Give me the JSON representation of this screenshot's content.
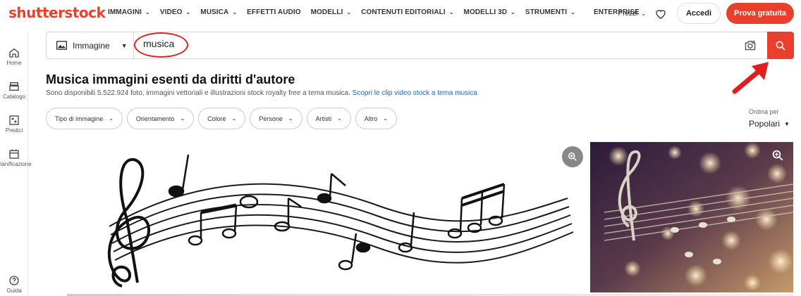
{
  "brand": {
    "logo_text": "shutterstock",
    "accent": "#e8402c"
  },
  "nav": {
    "items": [
      {
        "label": "IMMAGINI",
        "has_dropdown": true
      },
      {
        "label": "VIDEO",
        "has_dropdown": true
      },
      {
        "label": "MUSICA",
        "has_dropdown": true
      },
      {
        "label": "EFFETTI AUDIO",
        "has_dropdown": false
      },
      {
        "label": "MODELLI",
        "has_dropdown": true
      },
      {
        "label": "CONTENUTI EDITORIALI",
        "has_dropdown": true
      },
      {
        "label": "MODELLI 3D",
        "has_dropdown": true
      },
      {
        "label": "STRUMENTI",
        "has_dropdown": true
      },
      {
        "label": "ENTERPRISE",
        "has_dropdown": false
      }
    ],
    "prezzi": "Prezzi",
    "accedi": "Accedi",
    "prova": "Prova gratuita"
  },
  "sidebar": {
    "items": [
      {
        "label": "Home",
        "icon": "home-icon"
      },
      {
        "label": "Catalogo",
        "icon": "catalog-icon"
      },
      {
        "label": "Predici",
        "icon": "predict-icon"
      },
      {
        "label": "Pianificazione",
        "icon": "calendar-icon"
      }
    ],
    "help": "Guida"
  },
  "search": {
    "type_label": "Immagine",
    "query": "musica"
  },
  "page": {
    "title": "Musica immagini esenti da diritti d'autore",
    "subtitle": "Sono disponibili 5.522.924 foto, immagini vettoriali e illustrazioni stock royalty free a tema musica.",
    "link": "Scopri le clip video stock a tema musica"
  },
  "filters": [
    "Tipo di immagine",
    "Orientamento",
    "Colore",
    "Persone",
    "Artisti",
    "Altro"
  ],
  "sort": {
    "label": "Ordina per",
    "value": "Popolari"
  },
  "annotation_color": "#e0201c"
}
